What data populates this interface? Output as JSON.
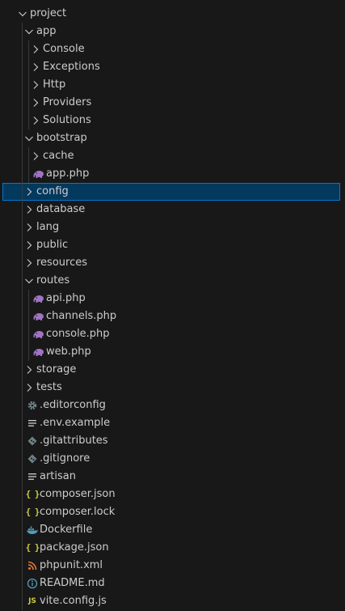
{
  "explorer": {
    "items": [
      {
        "label": "project",
        "kind": "folder",
        "expanded": true,
        "depth": 0,
        "icon": "chevron-down-icon"
      },
      {
        "label": "app",
        "kind": "folder",
        "expanded": true,
        "depth": 1,
        "icon": "chevron-down-icon"
      },
      {
        "label": "Console",
        "kind": "folder",
        "expanded": false,
        "depth": 2,
        "icon": "chevron-right-icon"
      },
      {
        "label": "Exceptions",
        "kind": "folder",
        "expanded": false,
        "depth": 2,
        "icon": "chevron-right-icon"
      },
      {
        "label": "Http",
        "kind": "folder",
        "expanded": false,
        "depth": 2,
        "icon": "chevron-right-icon"
      },
      {
        "label": "Providers",
        "kind": "folder",
        "expanded": false,
        "depth": 2,
        "icon": "chevron-right-icon"
      },
      {
        "label": "Solutions",
        "kind": "folder",
        "expanded": false,
        "depth": 2,
        "icon": "chevron-right-icon"
      },
      {
        "label": "bootstrap",
        "kind": "folder",
        "expanded": true,
        "depth": 1,
        "icon": "chevron-down-icon"
      },
      {
        "label": "cache",
        "kind": "folder",
        "expanded": false,
        "depth": 2,
        "icon": "chevron-right-icon"
      },
      {
        "label": "app.php",
        "kind": "file",
        "depth": 2,
        "icon": "php-elephant-icon"
      },
      {
        "label": "config",
        "kind": "folder",
        "expanded": false,
        "depth": 1,
        "icon": "chevron-right-icon",
        "selected": true
      },
      {
        "label": "database",
        "kind": "folder",
        "expanded": false,
        "depth": 1,
        "icon": "chevron-right-icon"
      },
      {
        "label": "lang",
        "kind": "folder",
        "expanded": false,
        "depth": 1,
        "icon": "chevron-right-icon"
      },
      {
        "label": "public",
        "kind": "folder",
        "expanded": false,
        "depth": 1,
        "icon": "chevron-right-icon"
      },
      {
        "label": "resources",
        "kind": "folder",
        "expanded": false,
        "depth": 1,
        "icon": "chevron-right-icon"
      },
      {
        "label": "routes",
        "kind": "folder",
        "expanded": true,
        "depth": 1,
        "icon": "chevron-down-icon"
      },
      {
        "label": "api.php",
        "kind": "file",
        "depth": 2,
        "icon": "php-elephant-icon"
      },
      {
        "label": "channels.php",
        "kind": "file",
        "depth": 2,
        "icon": "php-elephant-icon"
      },
      {
        "label": "console.php",
        "kind": "file",
        "depth": 2,
        "icon": "php-elephant-icon"
      },
      {
        "label": "web.php",
        "kind": "file",
        "depth": 2,
        "icon": "php-elephant-icon"
      },
      {
        "label": "storage",
        "kind": "folder",
        "expanded": false,
        "depth": 1,
        "icon": "chevron-right-icon"
      },
      {
        "label": "tests",
        "kind": "folder",
        "expanded": false,
        "depth": 1,
        "icon": "chevron-right-icon"
      },
      {
        "label": ".editorconfig",
        "kind": "file",
        "depth": 1,
        "icon": "gear-icon"
      },
      {
        "label": ".env.example",
        "kind": "file",
        "depth": 1,
        "icon": "lines-icon"
      },
      {
        "label": ".gitattributes",
        "kind": "file",
        "depth": 1,
        "icon": "git-diamond-icon"
      },
      {
        "label": ".gitignore",
        "kind": "file",
        "depth": 1,
        "icon": "git-diamond-icon"
      },
      {
        "label": "artisan",
        "kind": "file",
        "depth": 1,
        "icon": "lines-icon"
      },
      {
        "label": "composer.json",
        "kind": "file",
        "depth": 1,
        "icon": "json-braces-icon"
      },
      {
        "label": "composer.lock",
        "kind": "file",
        "depth": 1,
        "icon": "json-braces-icon"
      },
      {
        "label": "Dockerfile",
        "kind": "file",
        "depth": 1,
        "icon": "docker-whale-icon"
      },
      {
        "label": "package.json",
        "kind": "file",
        "depth": 1,
        "icon": "json-braces-icon"
      },
      {
        "label": "phpunit.xml",
        "kind": "file",
        "depth": 1,
        "icon": "rss-icon"
      },
      {
        "label": "README.md",
        "kind": "file",
        "depth": 1,
        "icon": "info-icon"
      },
      {
        "label": "vite.config.js",
        "kind": "file",
        "depth": 1,
        "icon": "js-icon"
      }
    ]
  },
  "colors": {
    "background": "#181818",
    "text": "#cccccc",
    "selection_bg": "#04395e",
    "selection_border": "#0078d4",
    "php_icon": "#a074c4",
    "json_icon": "#cbcb41",
    "docker_icon": "#519aba",
    "rss_icon": "#e37933",
    "info_icon": "#519aba",
    "muted_icon": "#6d8086",
    "guide": "#3a3a3a"
  }
}
